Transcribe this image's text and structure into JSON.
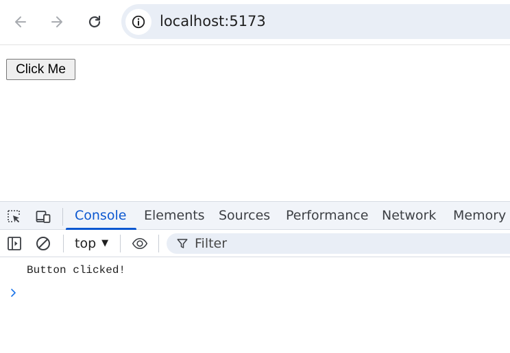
{
  "browser": {
    "url": "localhost:5173",
    "icons": {
      "back": "arrow-left-icon",
      "forward": "arrow-right-icon",
      "reload": "reload-icon",
      "site_info": "info-icon"
    }
  },
  "page": {
    "button_label": "Click Me"
  },
  "devtools": {
    "tabs": [
      {
        "label": "Console",
        "active": true
      },
      {
        "label": "Elements",
        "active": false
      },
      {
        "label": "Sources",
        "active": false
      },
      {
        "label": "Performance",
        "active": false
      },
      {
        "label": "Network",
        "active": false
      },
      {
        "label": "Memory",
        "active": false
      }
    ],
    "console_toolbar": {
      "context": "top",
      "filter_placeholder": "Filter"
    },
    "console_messages": [
      {
        "text": "Button clicked!"
      }
    ],
    "accent_color": "#0b57d0"
  }
}
